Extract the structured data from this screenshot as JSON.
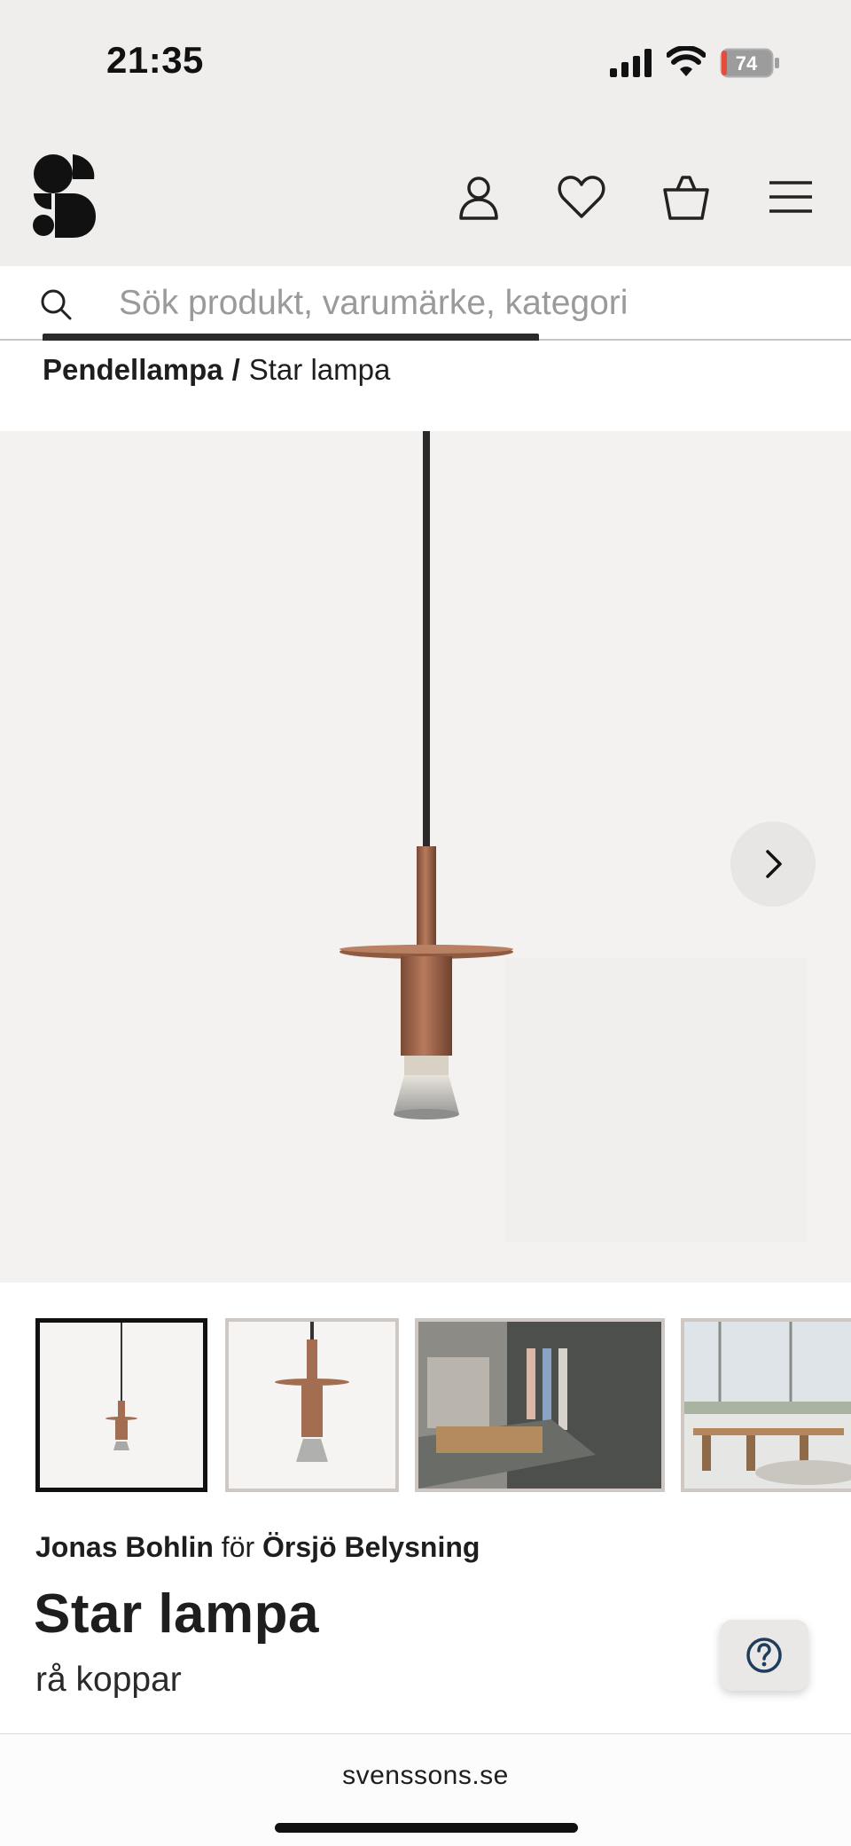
{
  "status_bar": {
    "time": "21:35",
    "battery_level": "74",
    "icons": [
      "signal-icon",
      "wifi-icon",
      "battery-icon"
    ]
  },
  "header": {
    "logo": "svenssons-logo",
    "icons": [
      "account-icon",
      "wishlist-heart-icon",
      "shopping-bag-icon",
      "menu-hamburger-icon"
    ]
  },
  "search": {
    "placeholder": "Sök produkt, varumärke, kategori",
    "value": ""
  },
  "breadcrumb": {
    "category": "Pendellampa",
    "separator": "/",
    "current": "Star lampa"
  },
  "gallery": {
    "next_icon": "chevron-right-icon",
    "thumbnail_count": 4,
    "active_thumbnail": 1
  },
  "product": {
    "designer": "Jonas Bohlin",
    "connector": "för",
    "brand": "Örsjö Belysning",
    "title": "Star lampa",
    "variant": "rå koppar"
  },
  "help": {
    "icon": "help-question-icon"
  },
  "browser": {
    "url": "svenssons.se"
  },
  "colors": {
    "header_bg": "#efeeec",
    "copper": "#a86a4e",
    "text": "#1e1e1e"
  }
}
